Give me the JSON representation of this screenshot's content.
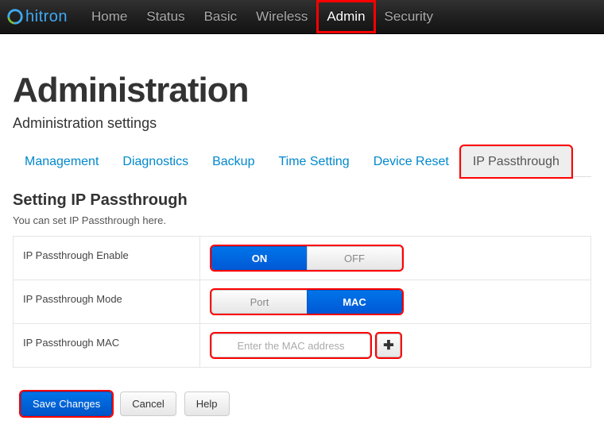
{
  "brand": {
    "name": "hitron"
  },
  "nav": {
    "items": [
      {
        "label": "Home",
        "active": false
      },
      {
        "label": "Status",
        "active": false
      },
      {
        "label": "Basic",
        "active": false
      },
      {
        "label": "Wireless",
        "active": false
      },
      {
        "label": "Admin",
        "active": true,
        "highlight": true
      },
      {
        "label": "Security",
        "active": false
      }
    ]
  },
  "page": {
    "title": "Administration",
    "subtitle": "Administration settings"
  },
  "tabs": [
    {
      "label": "Management",
      "active": false
    },
    {
      "label": "Diagnostics",
      "active": false
    },
    {
      "label": "Backup",
      "active": false
    },
    {
      "label": "Time Setting",
      "active": false
    },
    {
      "label": "Device Reset",
      "active": false
    },
    {
      "label": "IP Passthrough",
      "active": true,
      "highlight": true
    }
  ],
  "section": {
    "title": "Setting IP Passthrough",
    "desc": "You can set IP Passthrough here."
  },
  "rows": {
    "enable": {
      "label": "IP Passthrough Enable",
      "on": "ON",
      "off": "OFF",
      "value": "ON"
    },
    "mode": {
      "label": "IP Passthrough Mode",
      "port": "Port",
      "mac": "MAC",
      "value": "MAC"
    },
    "mac": {
      "label": "IP Passthrough MAC",
      "placeholder": "Enter the MAC address",
      "value": "",
      "add_icon": "✚"
    }
  },
  "actions": {
    "save": "Save Changes",
    "cancel": "Cancel",
    "help": "Help"
  }
}
